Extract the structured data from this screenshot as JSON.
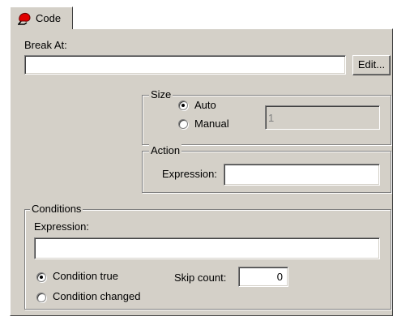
{
  "tab": {
    "label": "Code",
    "icon": "breakpoint-icon"
  },
  "break_at": {
    "label": "Break At:",
    "value": "",
    "edit_label": "Edit..."
  },
  "size": {
    "title": "Size",
    "auto_label": "Auto",
    "manual_label": "Manual",
    "selected": "Auto",
    "value": "1"
  },
  "action": {
    "title": "Action",
    "expression_label": "Expression:",
    "expression_value": ""
  },
  "conditions": {
    "title": "Conditions",
    "expression_label": "Expression:",
    "expression_value": "",
    "condition_true_label": "Condition true",
    "condition_changed_label": "Condition changed",
    "selected": "Condition true",
    "skip_count_label": "Skip count:",
    "skip_count_value": "0"
  }
}
